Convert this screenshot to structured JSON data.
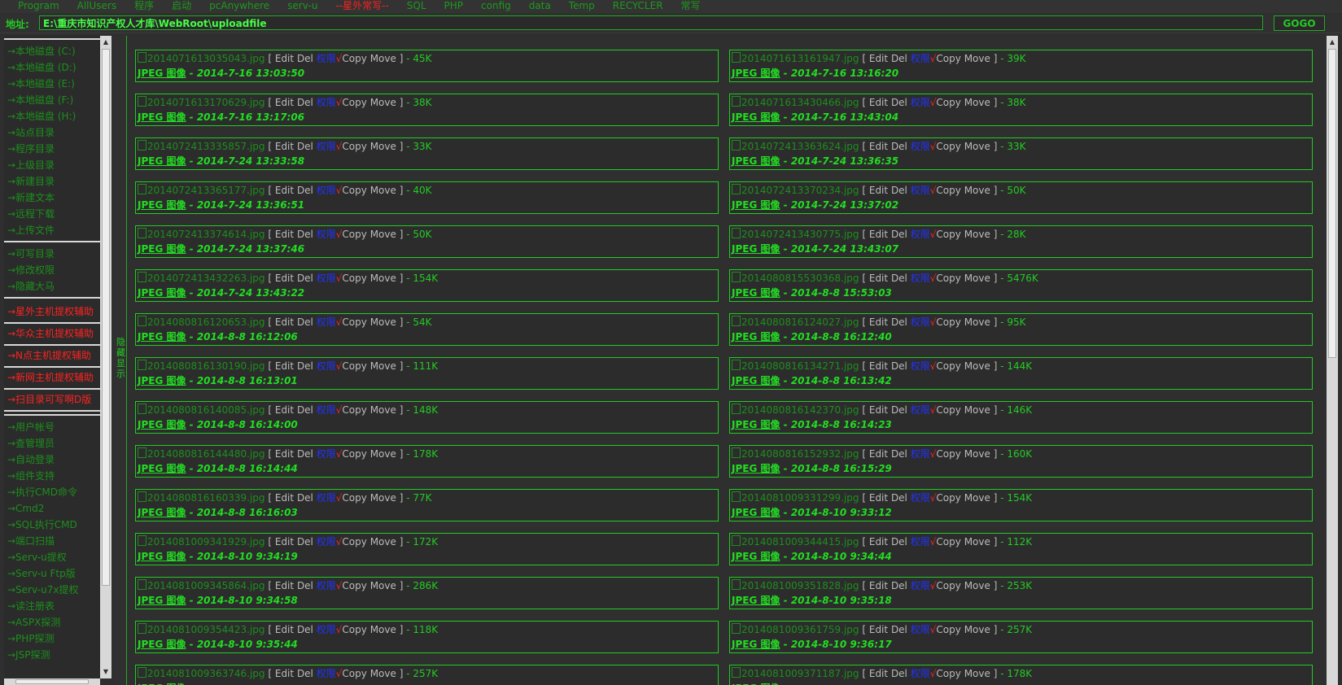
{
  "nav": [
    {
      "label": "Program",
      "red": false
    },
    {
      "label": "AllUsers",
      "red": false
    },
    {
      "label": "程序",
      "red": false
    },
    {
      "label": "启动",
      "red": false
    },
    {
      "label": "pcAnywhere",
      "red": false
    },
    {
      "label": "serv-u",
      "red": false
    },
    {
      "label": "--星外常写--",
      "red": true
    },
    {
      "label": "SQL",
      "red": false
    },
    {
      "label": "PHP",
      "red": false
    },
    {
      "label": "config",
      "red": false
    },
    {
      "label": "data",
      "red": false
    },
    {
      "label": "Temp",
      "red": false
    },
    {
      "label": "RECYCLER",
      "red": false
    },
    {
      "label": "常写",
      "red": false
    }
  ],
  "address": {
    "label": "地址:",
    "value": "E:\\重庆市知识产权人才库\\WebRoot\\uploadfile",
    "go_label": "GOGO"
  },
  "sidebar": {
    "groups": [
      [
        "→本地磁盘 (C:)",
        "→本地磁盘 (D:)",
        "→本地磁盘 (E:)",
        "→本地磁盘 (F:)",
        "→本地磁盘 (H:)",
        "→站点目录",
        "→程序目录",
        "→上级目录",
        "→新建目录",
        "→新建文本",
        "→远程下载",
        "→上传文件"
      ],
      [
        "→可写目录",
        "→修改权限",
        "→隐藏大马"
      ]
    ],
    "red_items": [
      "→星外主机提权辅助",
      "→华众主机提权辅助",
      "→N点主机提权辅助",
      "→新网主机提权辅助",
      "→扫目录可写啊D版"
    ],
    "bottom_items": [
      "→用户帐号",
      "→查管理员",
      "→自动登录",
      "→组件支持",
      "→执行CMD命令",
      "→Cmd2",
      "→SQL执行CMD",
      "→端口扫描",
      "→Serv-u提权",
      "→Serv-u Ftp版",
      "→Serv-u7x提权",
      "→读注册表",
      "→ASPX探测",
      "→PHP探测",
      "→JSP探测"
    ]
  },
  "toggle_label": "隐藏显示",
  "labels": {
    "edit": "Edit",
    "del": "Del",
    "perm": "权限",
    "check": "√",
    "copy": "Copy",
    "move": "Move",
    "type": "JPEG 图像"
  },
  "files": [
    {
      "name": "2014071613035043.jpg",
      "size": "45K",
      "date": "2014-7-16 13:03:50"
    },
    {
      "name": "2014071613161947.jpg",
      "size": "39K",
      "date": "2014-7-16 13:16:20"
    },
    {
      "name": "2014071613170629.jpg",
      "size": "38K",
      "date": "2014-7-16 13:17:06"
    },
    {
      "name": "2014071613430466.jpg",
      "size": "38K",
      "date": "2014-7-16 13:43:04"
    },
    {
      "name": "2014072413335857.jpg",
      "size": "33K",
      "date": "2014-7-24 13:33:58"
    },
    {
      "name": "2014072413363624.jpg",
      "size": "33K",
      "date": "2014-7-24 13:36:35"
    },
    {
      "name": "2014072413365177.jpg",
      "size": "40K",
      "date": "2014-7-24 13:36:51"
    },
    {
      "name": "2014072413370234.jpg",
      "size": "50K",
      "date": "2014-7-24 13:37:02"
    },
    {
      "name": "2014072413374614.jpg",
      "size": "50K",
      "date": "2014-7-24 13:37:46"
    },
    {
      "name": "2014072413430775.jpg",
      "size": "28K",
      "date": "2014-7-24 13:43:07"
    },
    {
      "name": "2014072413432263.jpg",
      "size": "154K",
      "date": "2014-7-24 13:43:22"
    },
    {
      "name": "2014080815530368.jpg",
      "size": "5476K",
      "date": "2014-8-8 15:53:03"
    },
    {
      "name": "2014080816120653.jpg",
      "size": "54K",
      "date": "2014-8-8 16:12:06"
    },
    {
      "name": "2014080816124027.jpg",
      "size": "95K",
      "date": "2014-8-8 16:12:40"
    },
    {
      "name": "2014080816130190.jpg",
      "size": "111K",
      "date": "2014-8-8 16:13:01"
    },
    {
      "name": "2014080816134271.jpg",
      "size": "144K",
      "date": "2014-8-8 16:13:42"
    },
    {
      "name": "2014080816140085.jpg",
      "size": "148K",
      "date": "2014-8-8 16:14:00"
    },
    {
      "name": "2014080816142370.jpg",
      "size": "146K",
      "date": "2014-8-8 16:14:23"
    },
    {
      "name": "2014080816144480.jpg",
      "size": "178K",
      "date": "2014-8-8 16:14:44"
    },
    {
      "name": "2014080816152932.jpg",
      "size": "160K",
      "date": "2014-8-8 16:15:29"
    },
    {
      "name": "2014080816160339.jpg",
      "size": "77K",
      "date": "2014-8-8 16:16:03"
    },
    {
      "name": "2014081009331299.jpg",
      "size": "154K",
      "date": "2014-8-10 9:33:12"
    },
    {
      "name": "2014081009341929.jpg",
      "size": "172K",
      "date": "2014-8-10 9:34:19"
    },
    {
      "name": "2014081009344415.jpg",
      "size": "112K",
      "date": "2014-8-10 9:34:44"
    },
    {
      "name": "2014081009345864.jpg",
      "size": "286K",
      "date": "2014-8-10 9:34:58"
    },
    {
      "name": "2014081009351828.jpg",
      "size": "253K",
      "date": "2014-8-10 9:35:18"
    },
    {
      "name": "2014081009354423.jpg",
      "size": "118K",
      "date": "2014-8-10 9:35:44"
    },
    {
      "name": "2014081009361759.jpg",
      "size": "257K",
      "date": "2014-8-10 9:36:17"
    },
    {
      "name": "2014081009363746.jpg",
      "size": "257K",
      "date": ""
    },
    {
      "name": "2014081009371187.jpg",
      "size": "178K",
      "date": ""
    }
  ]
}
